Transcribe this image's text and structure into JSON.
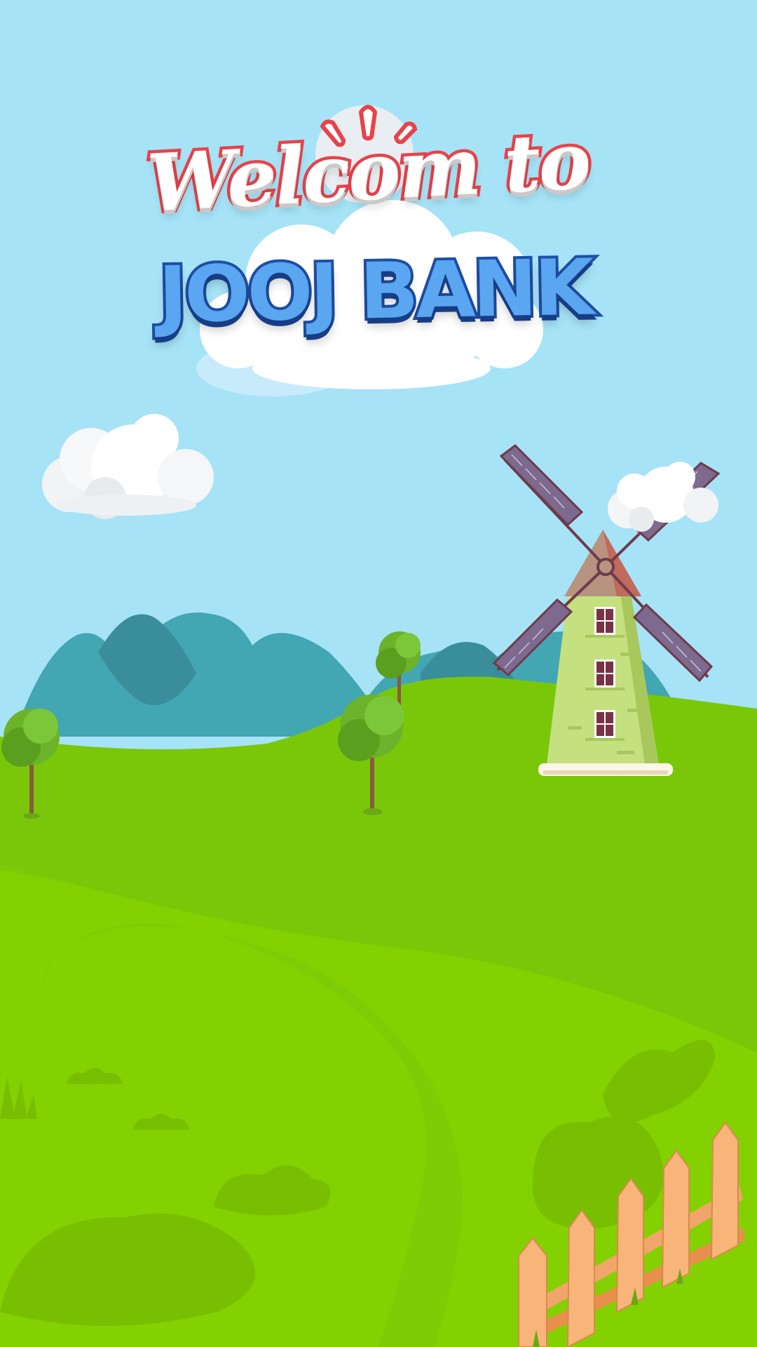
{
  "screen": {
    "name": "welcome-splash"
  },
  "title": {
    "line1": "Welcom to",
    "line2": "JOOJ BANK"
  },
  "colors": {
    "sky": "#a6e3f7",
    "grass_light": "#8ad900",
    "grass_mid": "#7ac70a",
    "mountain": "#42a6b3",
    "mountain_dark": "#3a8d9a",
    "title_red": "#e8434a",
    "title_blue": "#5aa6f0",
    "title_blue_outline": "#1f4fa6",
    "windmill_body": "#c4e07f",
    "windmill_roof": "#b89480",
    "windmill_sails": "#6e3b4c",
    "fence": "#f2a56a"
  },
  "decorations": {
    "clouds": [
      "cloud",
      "cloud",
      "title-cloud"
    ],
    "windmill": "windmill-icon",
    "trees": [
      "tree",
      "tree",
      "tree"
    ],
    "fence": "fence"
  }
}
